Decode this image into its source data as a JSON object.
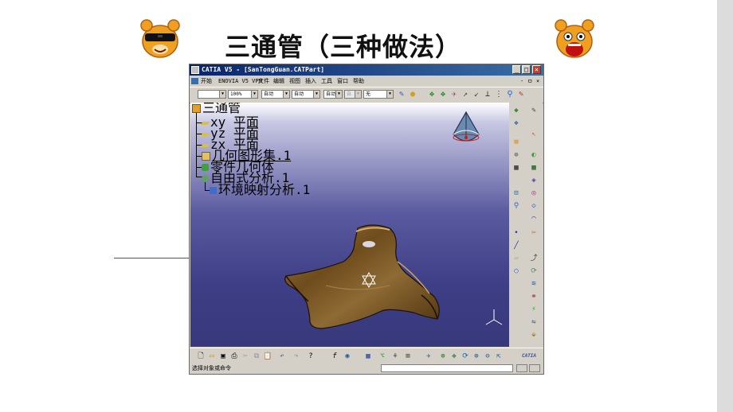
{
  "slide": {
    "title": "三通管（三种做法）"
  },
  "window": {
    "title": "CATIA V5 - [SanTongGuan.CATPart]",
    "controls": {
      "minimize": "_",
      "maximize": "□",
      "close": "×"
    }
  },
  "menu": {
    "items": [
      "开始",
      "ENOVIA V5 VPM",
      "文件",
      "编辑",
      "视图",
      "插入",
      "工具",
      "窗口",
      "帮助"
    ],
    "doc_controls": [
      "-",
      "ㅁ",
      "×"
    ]
  },
  "toolbar": {
    "line_combo": "",
    "zoom_combo": "100%",
    "combo3": "自动",
    "combo4": "自动",
    "combo5": "自动",
    "combo6": "自",
    "layer_combo": "无"
  },
  "tree": {
    "items": [
      {
        "label": "三通管",
        "icon": "part-icon"
      },
      {
        "label": "xy 平面",
        "icon": "plane-icon"
      },
      {
        "label": "yz 平面",
        "icon": "plane-icon"
      },
      {
        "label": "zx 平面",
        "icon": "plane-icon"
      },
      {
        "label": "几何图形集.1",
        "icon": "geometric-set-icon"
      },
      {
        "label": "零件几何体",
        "icon": "body-icon"
      },
      {
        "label": "自由式分析.1",
        "icon": "analysis-icon"
      },
      {
        "label": "环境映射分析.1",
        "icon": "environment-mapping-icon"
      }
    ]
  },
  "status": {
    "text": "选择对象或命令",
    "command_value": ""
  },
  "brand": {
    "logo_text": "CATIA",
    "title_bar_color": "#0a246a",
    "viewport_bottom_color": "#38387c",
    "model_color": "#7a5a2a"
  }
}
